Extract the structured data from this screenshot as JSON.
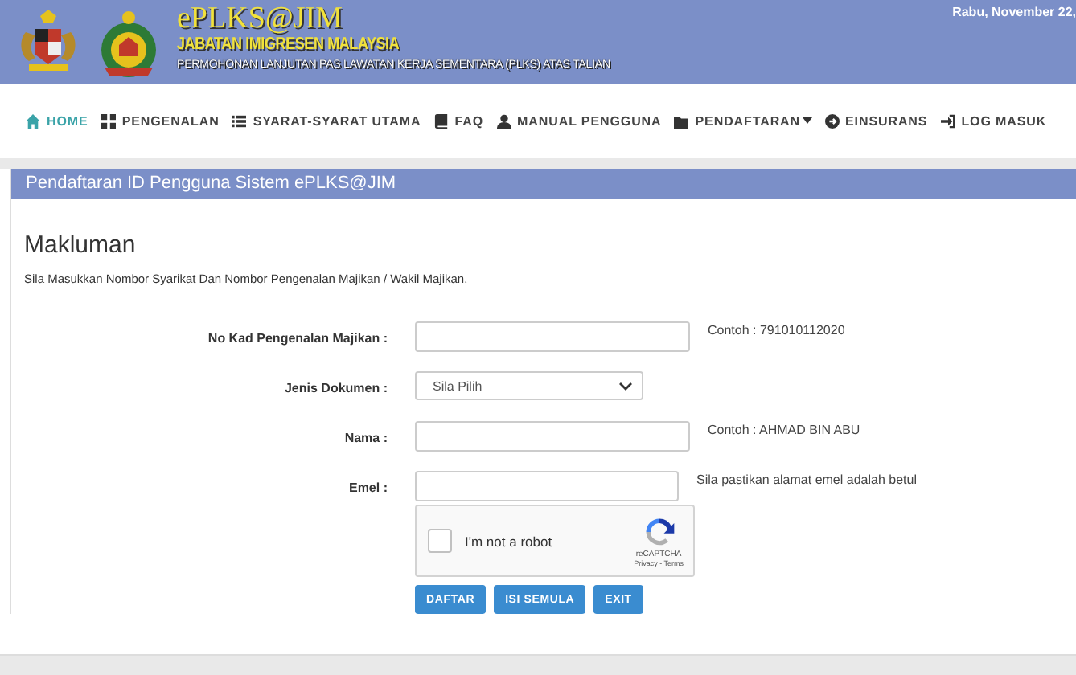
{
  "header": {
    "title": "ePLKS@JIM",
    "department": "JABATAN IMIGRESEN MALAYSIA",
    "subtitle": "PERMOHONAN LANJUTAN PAS LAWATAN KERJA SEMENTARA (PLKS) ATAS TALIAN",
    "date": "Rabu, November 22,"
  },
  "nav": [
    {
      "label": "HOME",
      "selected": true,
      "dropdown": false
    },
    {
      "label": "PENGENALAN",
      "selected": false,
      "dropdown": false
    },
    {
      "label": "SYARAT-SYARAT UTAMA",
      "selected": false,
      "dropdown": false
    },
    {
      "label": "FAQ",
      "selected": false,
      "dropdown": false
    },
    {
      "label": "MANUAL PENGGUNA",
      "selected": false,
      "dropdown": false
    },
    {
      "label": "PENDAFTARAN",
      "selected": false,
      "dropdown": true
    },
    {
      "label": "EINSURANS",
      "selected": false,
      "dropdown": false
    },
    {
      "label": "LOG MASUK",
      "selected": false,
      "dropdown": false
    }
  ],
  "panel": {
    "title": "Pendaftaran ID Pengguna Sistem ePLKS@JIM",
    "heading": "Makluman",
    "intro": "Sila Masukkan Nombor Syarikat Dan Nombor Pengenalan Majikan / Wakil Majikan.",
    "fields": [
      {
        "label": "No Kad Pengenalan Majikan :",
        "kind": "input",
        "hint": "Contoh : 791010112020"
      },
      {
        "label": "Jenis Dokumen :",
        "kind": "select",
        "value": "Sila Pilih"
      },
      {
        "label": "Nama :",
        "kind": "input",
        "hint": "Contoh : AHMAD BIN ABU"
      },
      {
        "label": "Emel :",
        "kind": "input",
        "hint": "Sila pastikan alamat emel adalah betul"
      }
    ],
    "captcha": {
      "label": "I'm not a robot",
      "checked": false,
      "brand": "reCAPTCHA",
      "links": "Privacy - Terms"
    },
    "buttons": [
      "DAFTAR",
      "ISI SEMULA",
      "EXIT"
    ]
  }
}
